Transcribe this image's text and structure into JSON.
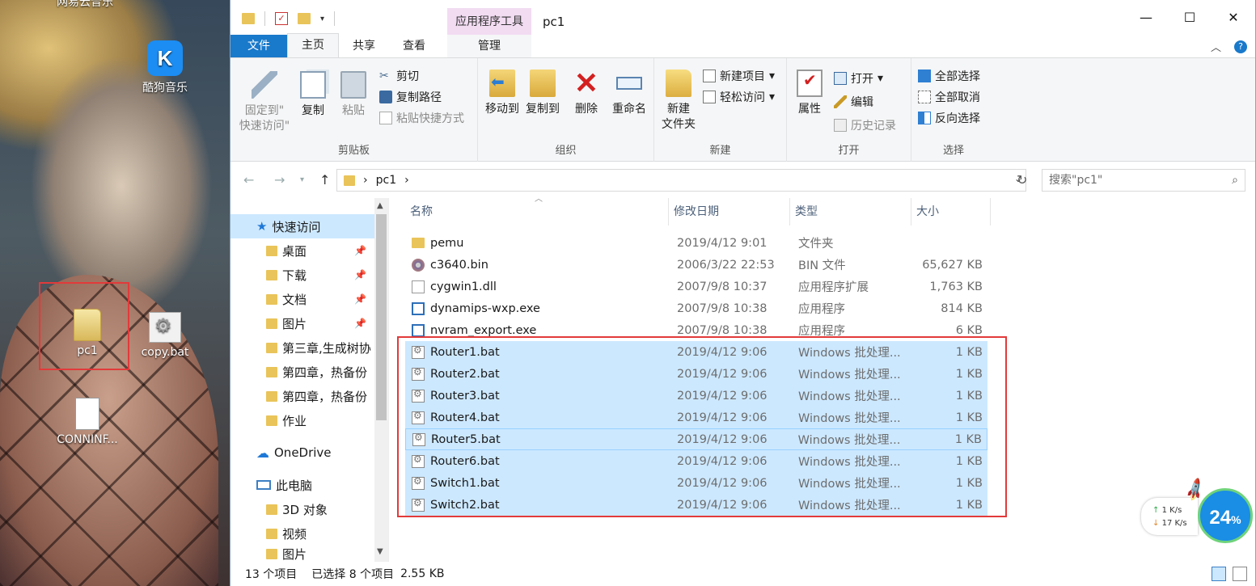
{
  "desktop": {
    "top_label": "网易云音乐",
    "icons": [
      {
        "label": "酷狗音乐",
        "glyph": "K"
      },
      {
        "label": "pc1"
      },
      {
        "label": "copy.bat"
      },
      {
        "label": "CONNINF..."
      }
    ]
  },
  "window": {
    "title": "pc1",
    "context_tab_group": "应用程序工具",
    "quick_access_toolbar": [
      "folder-icon",
      "properties-icon",
      "new-folder-icon",
      "chevron-down-icon"
    ],
    "controls": {
      "minimize": "—",
      "maximize": "☐",
      "close": "✕"
    }
  },
  "ribbon_tabs": [
    {
      "label": "文件"
    },
    {
      "label": "主页",
      "active": true
    },
    {
      "label": "共享"
    },
    {
      "label": "查看"
    },
    {
      "label": "管理"
    }
  ],
  "ribbon": {
    "clipboard": {
      "label": "剪贴板",
      "pin_line1": "固定到\"",
      "pin_line2": "快速访问\"",
      "copy": "复制",
      "paste": "粘贴",
      "cut": "剪切",
      "copy_path": "复制路径",
      "paste_shortcut": "粘贴快捷方式"
    },
    "organize": {
      "label": "组织",
      "move_to": "移动到",
      "copy_to": "复制到",
      "delete": "删除",
      "rename": "重命名"
    },
    "new": {
      "label": "新建",
      "new_folder_line1": "新建",
      "new_folder_line2": "文件夹",
      "new_item": "新建项目",
      "easy_access": "轻松访问"
    },
    "open": {
      "label": "打开",
      "properties": "属性",
      "open": "打开",
      "edit": "编辑",
      "history": "历史记录"
    },
    "select": {
      "label": "选择",
      "select_all": "全部选择",
      "select_none": "全部取消",
      "invert": "反向选择"
    }
  },
  "address": {
    "path": "pc1",
    "search_placeholder": "搜索\"pc1\""
  },
  "nav_pane": [
    {
      "label": "快速访问",
      "icon": "star-icon",
      "selected": true
    },
    {
      "label": "桌面",
      "icon": "folder-icon",
      "pinned": true
    },
    {
      "label": "下载",
      "icon": "folder-icon",
      "pinned": true
    },
    {
      "label": "文档",
      "icon": "folder-icon",
      "pinned": true
    },
    {
      "label": "图片",
      "icon": "folder-icon",
      "pinned": true
    },
    {
      "label": "第三章,生成树协",
      "icon": "folder-icon"
    },
    {
      "label": "第四章，热备份",
      "icon": "folder-icon"
    },
    {
      "label": "第四章，热备份",
      "icon": "folder-icon"
    },
    {
      "label": "作业",
      "icon": "folder-icon"
    },
    {
      "label": "OneDrive",
      "icon": "cloud-icon"
    },
    {
      "label": "此电脑",
      "icon": "computer-icon"
    },
    {
      "label": "3D 对象",
      "icon": "folder-icon"
    },
    {
      "label": "视频",
      "icon": "folder-icon"
    },
    {
      "label": "图片",
      "icon": "folder-icon"
    }
  ],
  "columns": {
    "name": "名称",
    "date": "修改日期",
    "type": "类型",
    "size": "大小"
  },
  "files": [
    {
      "name": "pemu",
      "date": "2019/4/12 9:01",
      "type": "文件夹",
      "size": "",
      "icon": "folder"
    },
    {
      "name": "c3640.bin",
      "date": "2006/3/22 22:53",
      "type": "BIN 文件",
      "size": "65,627 KB",
      "icon": "bin"
    },
    {
      "name": "cygwin1.dll",
      "date": "2007/9/8 10:37",
      "type": "应用程序扩展",
      "size": "1,763 KB",
      "icon": "dll"
    },
    {
      "name": "dynamips-wxp.exe",
      "date": "2007/9/8 10:38",
      "type": "应用程序",
      "size": "814 KB",
      "icon": "exe"
    },
    {
      "name": "nvram_export.exe",
      "date": "2007/9/8 10:38",
      "type": "应用程序",
      "size": "6 KB",
      "icon": "exe"
    },
    {
      "name": "Router1.bat",
      "date": "2019/4/12 9:06",
      "type": "Windows 批处理...",
      "size": "1 KB",
      "icon": "bat",
      "selected": true
    },
    {
      "name": "Router2.bat",
      "date": "2019/4/12 9:06",
      "type": "Windows 批处理...",
      "size": "1 KB",
      "icon": "bat",
      "selected": true
    },
    {
      "name": "Router3.bat",
      "date": "2019/4/12 9:06",
      "type": "Windows 批处理...",
      "size": "1 KB",
      "icon": "bat",
      "selected": true
    },
    {
      "name": "Router4.bat",
      "date": "2019/4/12 9:06",
      "type": "Windows 批处理...",
      "size": "1 KB",
      "icon": "bat",
      "selected": true
    },
    {
      "name": "Router5.bat",
      "date": "2019/4/12 9:06",
      "type": "Windows 批处理...",
      "size": "1 KB",
      "icon": "bat",
      "selected": true,
      "focused": true
    },
    {
      "name": "Router6.bat",
      "date": "2019/4/12 9:06",
      "type": "Windows 批处理...",
      "size": "1 KB",
      "icon": "bat",
      "selected": true
    },
    {
      "name": "Switch1.bat",
      "date": "2019/4/12 9:06",
      "type": "Windows 批处理...",
      "size": "1 KB",
      "icon": "bat",
      "selected": true
    },
    {
      "name": "Switch2.bat",
      "date": "2019/4/12 9:06",
      "type": "Windows 批处理...",
      "size": "1 KB",
      "icon": "bat",
      "selected": true
    }
  ],
  "status": {
    "item_count": "13 个项目",
    "selected": "已选择 8 个项目",
    "selected_size": "2.55 KB"
  },
  "speed_widget": {
    "up": "1",
    "up_unit": "K/s",
    "down": "17",
    "down_unit": "K/s",
    "percent": "24",
    "percent_unit": "%"
  },
  "colors": {
    "accent": "#1979ca",
    "selection": "#cce8ff",
    "annotation_red": "#e23a3a",
    "context_tab": "#f2dcf2"
  }
}
